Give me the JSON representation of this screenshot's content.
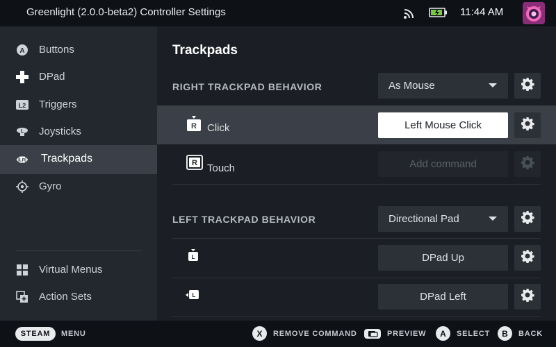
{
  "window": {
    "title": "Greenlight (2.0.0-beta2) Controller Settings",
    "clock": "11:44 AM",
    "icons": [
      "wifi-icon",
      "battery-icon",
      "avatar"
    ]
  },
  "sidebar": {
    "items": [
      {
        "label": "Buttons",
        "icon": "a-button-icon"
      },
      {
        "label": "DPad",
        "icon": "dpad-icon"
      },
      {
        "label": "Triggers",
        "icon": "l2-trigger-icon"
      },
      {
        "label": "Joysticks",
        "icon": "joystick-icon"
      },
      {
        "label": "Trackpads",
        "icon": "trackpad-icon",
        "active": true
      },
      {
        "label": "Gyro",
        "icon": "gyro-icon"
      }
    ],
    "bottom_items": [
      {
        "label": "Virtual Menus",
        "icon": "grid-icon"
      },
      {
        "label": "Action Sets",
        "icon": "action-sets-icon"
      }
    ]
  },
  "main": {
    "title": "Trackpads",
    "right": {
      "header": "RIGHT TRACKPAD BEHAVIOR",
      "mode": "As Mouse",
      "rows": [
        {
          "label": "Click",
          "icon": "right-pad-click-icon",
          "command": "Left Mouse Click"
        },
        {
          "label": "Touch",
          "icon": "right-pad-touch-icon",
          "command": "Add command"
        }
      ]
    },
    "left": {
      "header": "LEFT TRACKPAD BEHAVIOR",
      "mode": "Directional Pad",
      "rows": [
        {
          "label": "",
          "icon": "left-pad-up-icon",
          "command": "DPad Up"
        },
        {
          "label": "",
          "icon": "left-pad-left-icon",
          "command": "DPad Left"
        }
      ]
    }
  },
  "footer": {
    "steam": "STEAM",
    "menu": "MENU",
    "x_glyph": "X",
    "remove": "REMOVE COMMAND",
    "preview": "PREVIEW",
    "a_glyph": "A",
    "select": "SELECT",
    "b_glyph": "B",
    "back": "BACK"
  }
}
